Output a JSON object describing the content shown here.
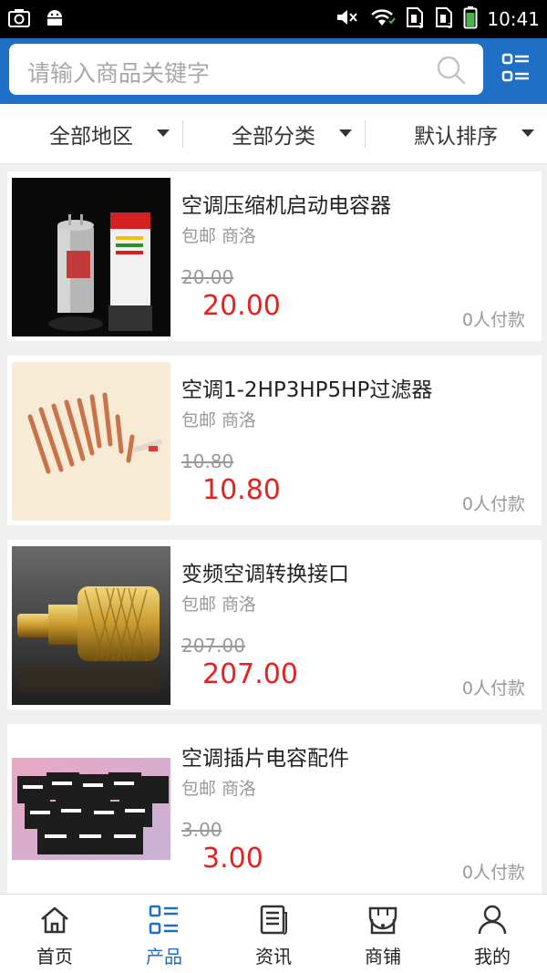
{
  "status_bar": {
    "time": "10:41",
    "left_icons": [
      "screenshot-icon",
      "android-icon"
    ],
    "right_icons": [
      "mute-icon",
      "wifi-icon",
      "sim1-icon",
      "sim2-icon",
      "battery-icon"
    ]
  },
  "search": {
    "placeholder": "请输入商品关键字"
  },
  "filters": [
    {
      "label": "全部地区"
    },
    {
      "label": "全部分类"
    },
    {
      "label": "默认排序"
    }
  ],
  "products": [
    {
      "title": "空调压缩机启动电容器",
      "tags": "包邮 商洛",
      "old_price": "20.00",
      "price": "20.00",
      "sold": "0人付款"
    },
    {
      "title": "空调1-2HP3HP5HP过滤器",
      "tags": "包邮 商洛",
      "old_price": "10.80",
      "price": "10.80",
      "sold": "0人付款"
    },
    {
      "title": "变频空调转换接口",
      "tags": "包邮 商洛",
      "old_price": "207.00",
      "price": "207.00",
      "sold": "0人付款"
    },
    {
      "title": "空调插片电容配件",
      "tags": "包邮 商洛",
      "old_price": "3.00",
      "price": "3.00",
      "sold": "0人付款"
    }
  ],
  "bottom_nav": [
    {
      "label": "首页",
      "icon": "home-icon"
    },
    {
      "label": "产品",
      "icon": "products-icon",
      "active": true
    },
    {
      "label": "资讯",
      "icon": "news-icon"
    },
    {
      "label": "商铺",
      "icon": "store-icon"
    },
    {
      "label": "我的",
      "icon": "profile-icon"
    }
  ],
  "colors": {
    "brand": "#1f6fc4",
    "price": "#e8201e",
    "muted": "#999999"
  }
}
